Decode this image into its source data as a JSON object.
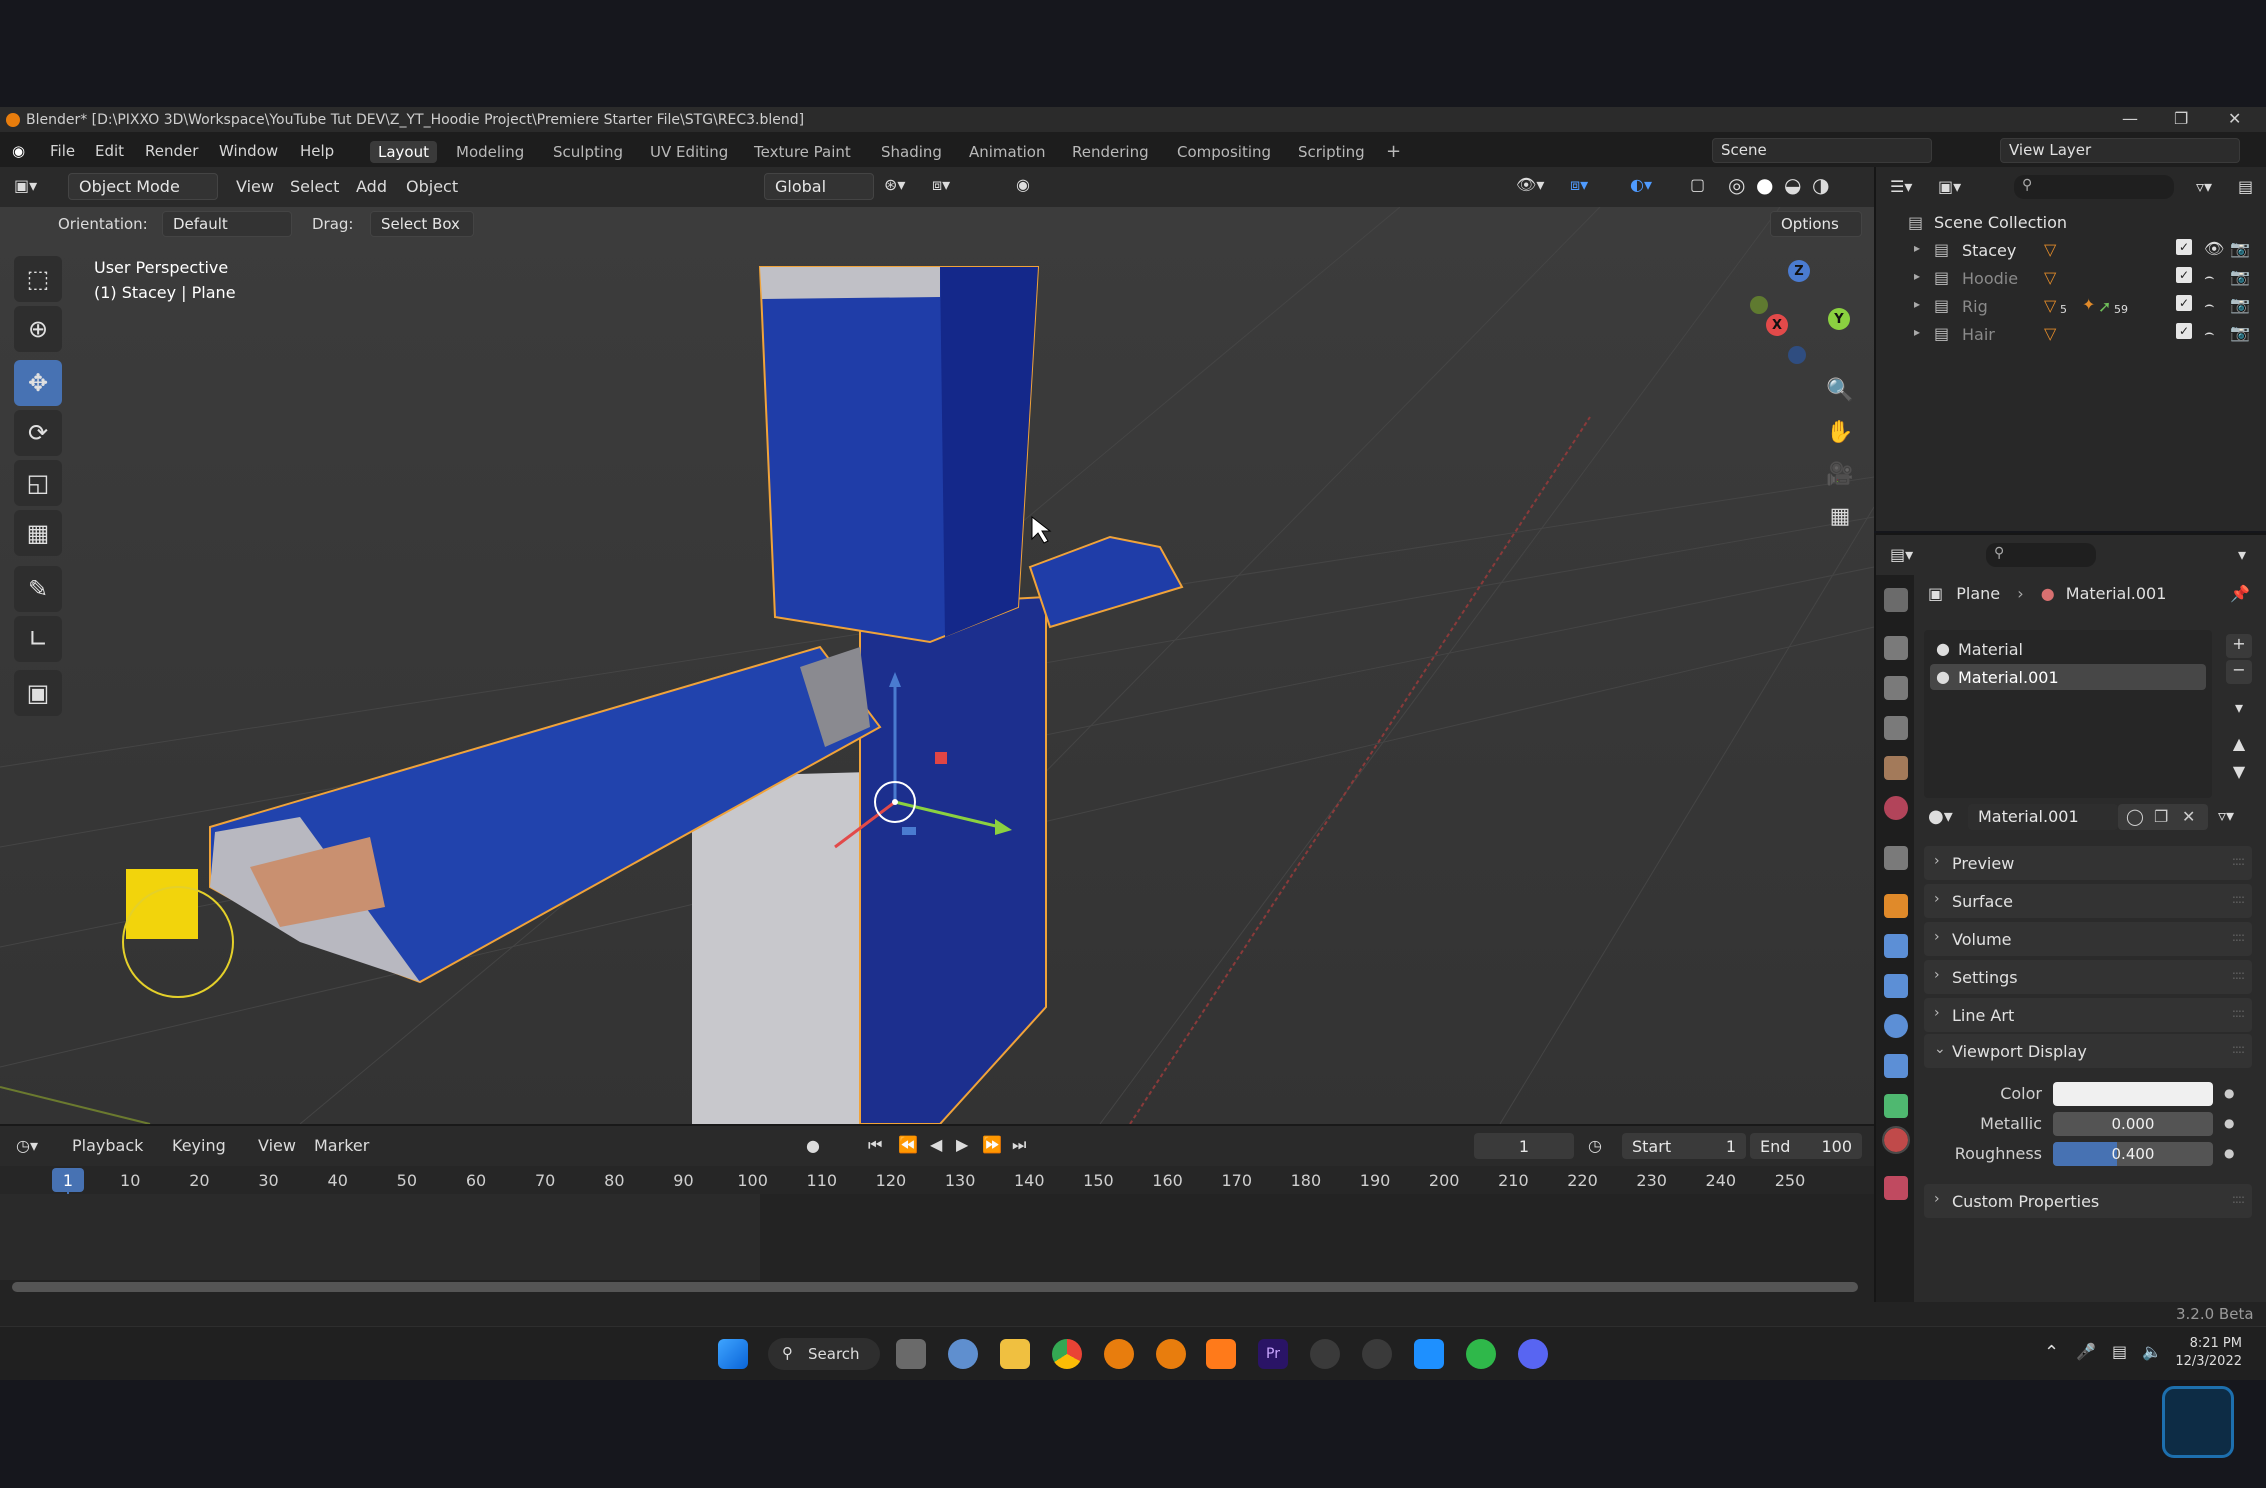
{
  "window": {
    "title": "Blender* [D:\\PIXXO 3D\\Workspace\\YouTube Tut DEV\\Z_YT_Hoodie Project\\Premiere Starter File\\STG\\REC3.blend]"
  },
  "menu": {
    "items": [
      "File",
      "Edit",
      "Render",
      "Window",
      "Help"
    ]
  },
  "workspaces": {
    "tabs": [
      "Layout",
      "Modeling",
      "Sculpting",
      "UV Editing",
      "Texture Paint",
      "Shading",
      "Animation",
      "Rendering",
      "Compositing",
      "Scripting"
    ],
    "active": "Layout",
    "add": "+"
  },
  "scene": {
    "name": "Scene",
    "view_layer": "View Layer"
  },
  "viewport_header": {
    "mode": "Object Mode",
    "menus": [
      "View",
      "Select",
      "Add",
      "Object"
    ],
    "transform_orientation": "Global",
    "orientation_label": "Orientation:",
    "orientation_value": "Default",
    "drag_label": "Drag:",
    "drag_value": "Select Box",
    "options": "Options"
  },
  "viewport": {
    "info_line1": "User Perspective",
    "info_line2": "(1) Stacey | Plane",
    "gizmo_axes": {
      "x": "X",
      "y": "Y",
      "z": "Z"
    }
  },
  "outliner": {
    "root": "Scene Collection",
    "collections": [
      {
        "name": "Stacey",
        "dim": false,
        "badge": ""
      },
      {
        "name": "Hoodie",
        "dim": true,
        "badge": ""
      },
      {
        "name": "Rig",
        "dim": true,
        "badge": "5",
        "badge2": "59"
      },
      {
        "name": "Hair",
        "dim": true,
        "badge": ""
      }
    ]
  },
  "properties": {
    "breadcrumb_object": "Plane",
    "breadcrumb_material": "Material.001",
    "slots": [
      "Material",
      "Material.001"
    ],
    "active_slot": "Material.001",
    "material_name": "Material.001",
    "panels": [
      "Preview",
      "Surface",
      "Volume",
      "Settings",
      "Line Art"
    ],
    "open_panel": "Viewport Display",
    "viewport_display": {
      "color_label": "Color",
      "metallic_label": "Metallic",
      "metallic_value": "0.000",
      "roughness_label": "Roughness",
      "roughness_value": "0.400",
      "roughness_fraction": 0.4
    },
    "custom_props": "Custom Properties"
  },
  "timeline": {
    "menus": [
      "Playback",
      "Keying",
      "View",
      "Marker"
    ],
    "current_frame": "1",
    "start_label": "Start",
    "start_value": "1",
    "end_label": "End",
    "end_value": "100",
    "ticks": [
      "1",
      "10",
      "20",
      "30",
      "40",
      "50",
      "60",
      "70",
      "80",
      "90",
      "100",
      "110",
      "120",
      "130",
      "140",
      "150",
      "160",
      "170",
      "180",
      "190",
      "200",
      "210",
      "220",
      "230",
      "240",
      "250"
    ]
  },
  "status": {
    "version": "3.2.0 Beta"
  },
  "taskbar": {
    "search": "Search",
    "time": "8:21 PM",
    "date": "12/3/2022"
  }
}
